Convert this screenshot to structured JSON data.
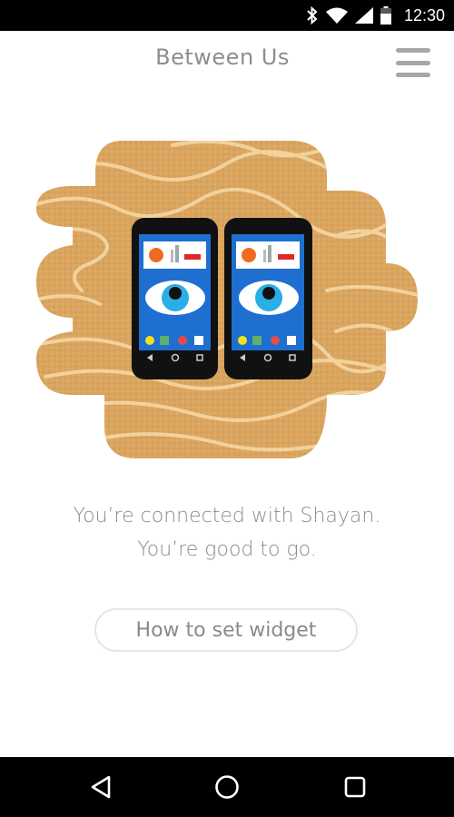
{
  "status_bar": {
    "time": "12:30",
    "icons": [
      "bluetooth-icon",
      "wifi-icon",
      "signal-icon",
      "battery-icon"
    ]
  },
  "header": {
    "title": "Between Us",
    "menu_icon": "hamburger-menu-icon"
  },
  "illustration": {
    "description_icon": "two-phones-eye-illustration",
    "background_color": "#d9a55f",
    "stripe_color": "#f3d7a4",
    "screen_color": "#1e6fd0",
    "dock_dot_colors": [
      "#f3e11a",
      "#5fb06a",
      "#e14d4d",
      "#ffffff"
    ]
  },
  "message": {
    "line1": "You’re connected with Shayan.",
    "line2": "You’re good to go."
  },
  "widget_button": {
    "label": "How to set widget"
  },
  "nav_bar": {
    "back": "back-triangle-icon",
    "home": "home-circle-icon",
    "recents": "recents-square-icon"
  }
}
